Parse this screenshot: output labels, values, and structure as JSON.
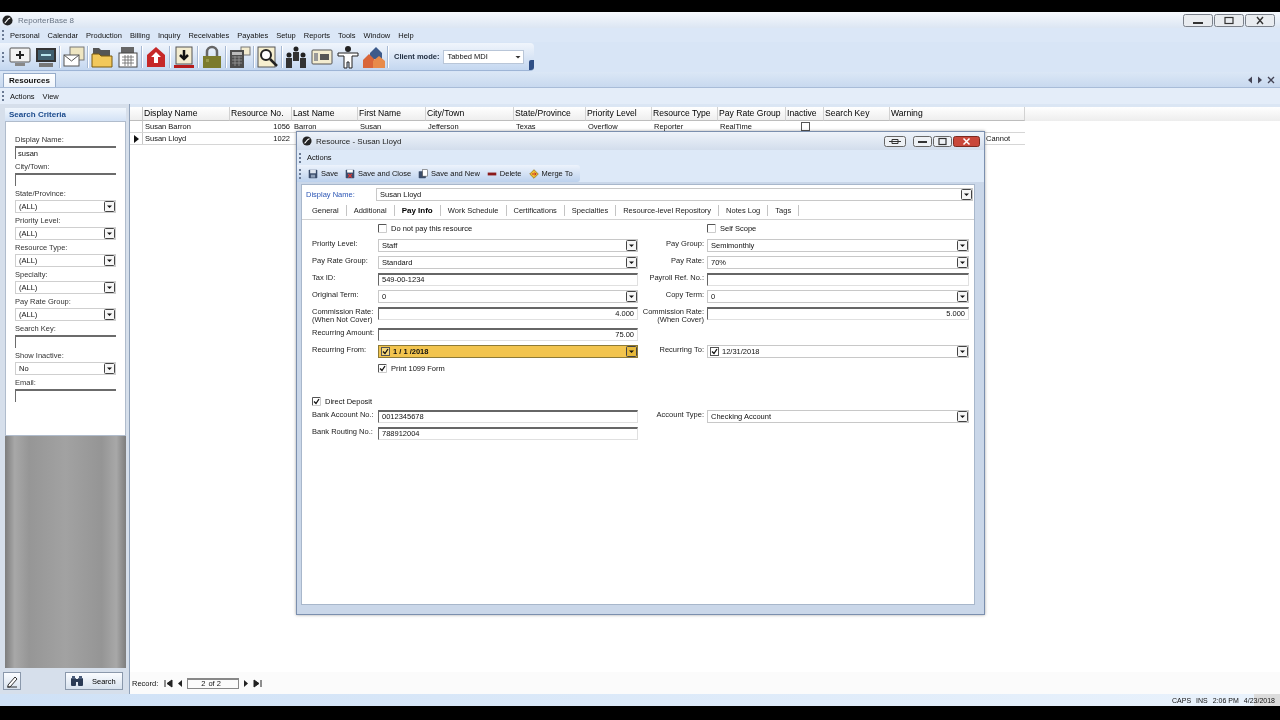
{
  "window": {
    "title": "ReporterBase 8"
  },
  "menu": [
    "Personal",
    "Calendar",
    "Production",
    "Billing",
    "Inquiry",
    "Receivables",
    "Payables",
    "Setup",
    "Reports",
    "Tools",
    "Window",
    "Help"
  ],
  "toolbar": {
    "client_mode": {
      "label": "Client mode:",
      "value": "Tabbed MDI"
    }
  },
  "tabs": [
    {
      "label": "Resources",
      "selected": true
    }
  ],
  "view_menu": [
    "Actions",
    "View"
  ],
  "search_panel": {
    "title": "Search Criteria",
    "fields": [
      {
        "kind": "text",
        "label": "Display Name:",
        "value": "susan"
      },
      {
        "kind": "text",
        "label": "City/Town:"
      },
      {
        "kind": "dropdown",
        "label": "State/Province:",
        "value": "(ALL)"
      },
      {
        "kind": "dropdown",
        "label": "Priority Level:",
        "value": "(ALL)"
      },
      {
        "kind": "dropdown",
        "label": "Resource Type:",
        "value": "(ALL)"
      },
      {
        "kind": "dropdown",
        "label": "Specialty:",
        "value": "(ALL)"
      },
      {
        "kind": "dropdown",
        "label": "Pay Rate Group:",
        "value": "(ALL)"
      },
      {
        "kind": "text",
        "label": "Search Key:"
      },
      {
        "kind": "dropdown",
        "label": "Show Inactive:",
        "value": "No"
      },
      {
        "kind": "text",
        "label": "Email:"
      }
    ],
    "search_button": "Search"
  },
  "grid": {
    "columns": [
      "Display Name",
      "Resource No.",
      "Last Name",
      "First Name",
      "City/Town",
      "State/Province",
      "Priority Level",
      "Resource Type",
      "Pay Rate Group",
      "Inactive",
      "Search Key",
      "Warning"
    ],
    "rows": [
      {
        "selected": false,
        "display_name": "Susan Barron",
        "resource_no": "1056",
        "last_name": "Barron",
        "first_name": "Susan",
        "city_town": "Jefferson",
        "state_province": "Texas",
        "priority_level": "Overflow",
        "resource_type": "Reporter",
        "pay_rate_group": "RealTime",
        "inactive": false
      },
      {
        "selected": true,
        "display_name": "Susan Lloyd",
        "resource_no": "1022",
        "warning": "Cannot"
      }
    ]
  },
  "record_nav": {
    "label": "Record:",
    "current": "2",
    "total": "of 2"
  },
  "dialog": {
    "title": "Resource - Susan Lloyd",
    "menu": [
      "Actions"
    ],
    "toolbar": [
      {
        "kind": "save",
        "label": "Save"
      },
      {
        "kind": "save_close",
        "label": "Save and Close"
      },
      {
        "kind": "save_new",
        "label": "Save and New"
      },
      {
        "kind": "delete",
        "label": "Delete"
      },
      {
        "kind": "merge",
        "label": "Merge To"
      }
    ],
    "display_name": {
      "label": "Display Name:",
      "value": "Susan Lloyd"
    },
    "tabs": [
      {
        "label": "General",
        "selected": false
      },
      {
        "label": "Additional",
        "selected": false
      },
      {
        "label": "Pay Info",
        "selected": true
      },
      {
        "label": "Work Schedule",
        "selected": false
      },
      {
        "label": "Certifications",
        "selected": false
      },
      {
        "label": "Specialties",
        "selected": false
      },
      {
        "label": "Resource-level Repository",
        "selected": false
      },
      {
        "label": "Notes Log",
        "selected": false
      },
      {
        "label": "Tags",
        "selected": false
      }
    ],
    "sections": [
      {
        "rows": [
          {
            "left": {
              "kind": "checkbox",
              "label": "Do not pay this resource",
              "checked": false
            },
            "right": {
              "kind": "checkbox",
              "label": "Self Scope",
              "checked": false
            }
          },
          {
            "left": {
              "kind": "dropdown",
              "label": "Priority Level:",
              "value": "Staff"
            },
            "right": {
              "kind": "dropdown",
              "label": "Pay Group:",
              "value": "Semimonthly"
            }
          },
          {
            "left": {
              "kind": "dropdown",
              "label": "Pay Rate Group:",
              "value": "Standard"
            },
            "right": {
              "kind": "dropdown",
              "label": "Pay Rate:",
              "value": "70%"
            }
          },
          {
            "left": {
              "kind": "text",
              "label": "Tax ID:",
              "value": "549-00-1234"
            },
            "right": {
              "kind": "text",
              "label": "Payroll Ref. No.:"
            }
          },
          {
            "left": {
              "kind": "dropdown",
              "label": "Original Term:",
              "value": "0"
            },
            "right": {
              "kind": "dropdown",
              "label": "Copy Term:",
              "value": "0"
            }
          },
          {
            "left": {
              "kind": "number",
              "label": "Commission Rate:\n(When Not Cover)",
              "value": "4.000"
            },
            "right": {
              "kind": "number",
              "label": "Commission Rate:\n(When Cover)",
              "value": "5.000"
            }
          },
          {
            "left": {
              "kind": "number",
              "label": "Recurring Amount:",
              "value": "75.00"
            }
          },
          {
            "left": {
              "kind": "date",
              "label": "Recurring From:",
              "value": "1 / 1 /2018",
              "checked": true,
              "focused": true
            },
            "right": {
              "kind": "date",
              "label": "Recurring To:",
              "value": "12/31/2018",
              "checked": true,
              "focused": false
            }
          },
          {
            "left": {
              "kind": "checkbox",
              "label": "Print 1099 Form",
              "checked": true
            }
          }
        ]
      },
      {
        "header": {
          "label": "Direct Deposit",
          "checked": true
        },
        "rows": [
          {
            "left": {
              "kind": "text",
              "label": "Bank Account No.:",
              "value": "0012345678"
            },
            "right": {
              "kind": "dropdown",
              "label": "Account Type:",
              "value": "Checking Account"
            }
          },
          {
            "left": {
              "kind": "text",
              "label": "Bank Routing No.:",
              "value": "788912004"
            }
          }
        ]
      }
    ]
  },
  "status_bar": [
    "CAPS",
    "INS",
    "2:06 PM",
    "4/23/2018"
  ]
}
